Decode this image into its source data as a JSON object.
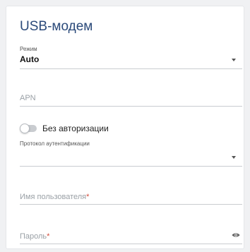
{
  "panel": {
    "title": "USB-модем"
  },
  "mode": {
    "label": "Режим",
    "value": "Auto"
  },
  "apn": {
    "placeholder": "APN"
  },
  "auth_toggle": {
    "label": "Без авторизации",
    "on": false
  },
  "auth_protocol": {
    "label": "Протокол аутентификации",
    "value": ""
  },
  "username": {
    "placeholder": "Имя пользователя",
    "required_mark": "*"
  },
  "password": {
    "placeholder": "Пароль",
    "required_mark": "*"
  },
  "icons": {
    "dropdown": "chevron-down-icon",
    "password_visibility": "eye-icon"
  },
  "colors": {
    "title": "#2b4a7a",
    "required": "#d24b3a"
  }
}
